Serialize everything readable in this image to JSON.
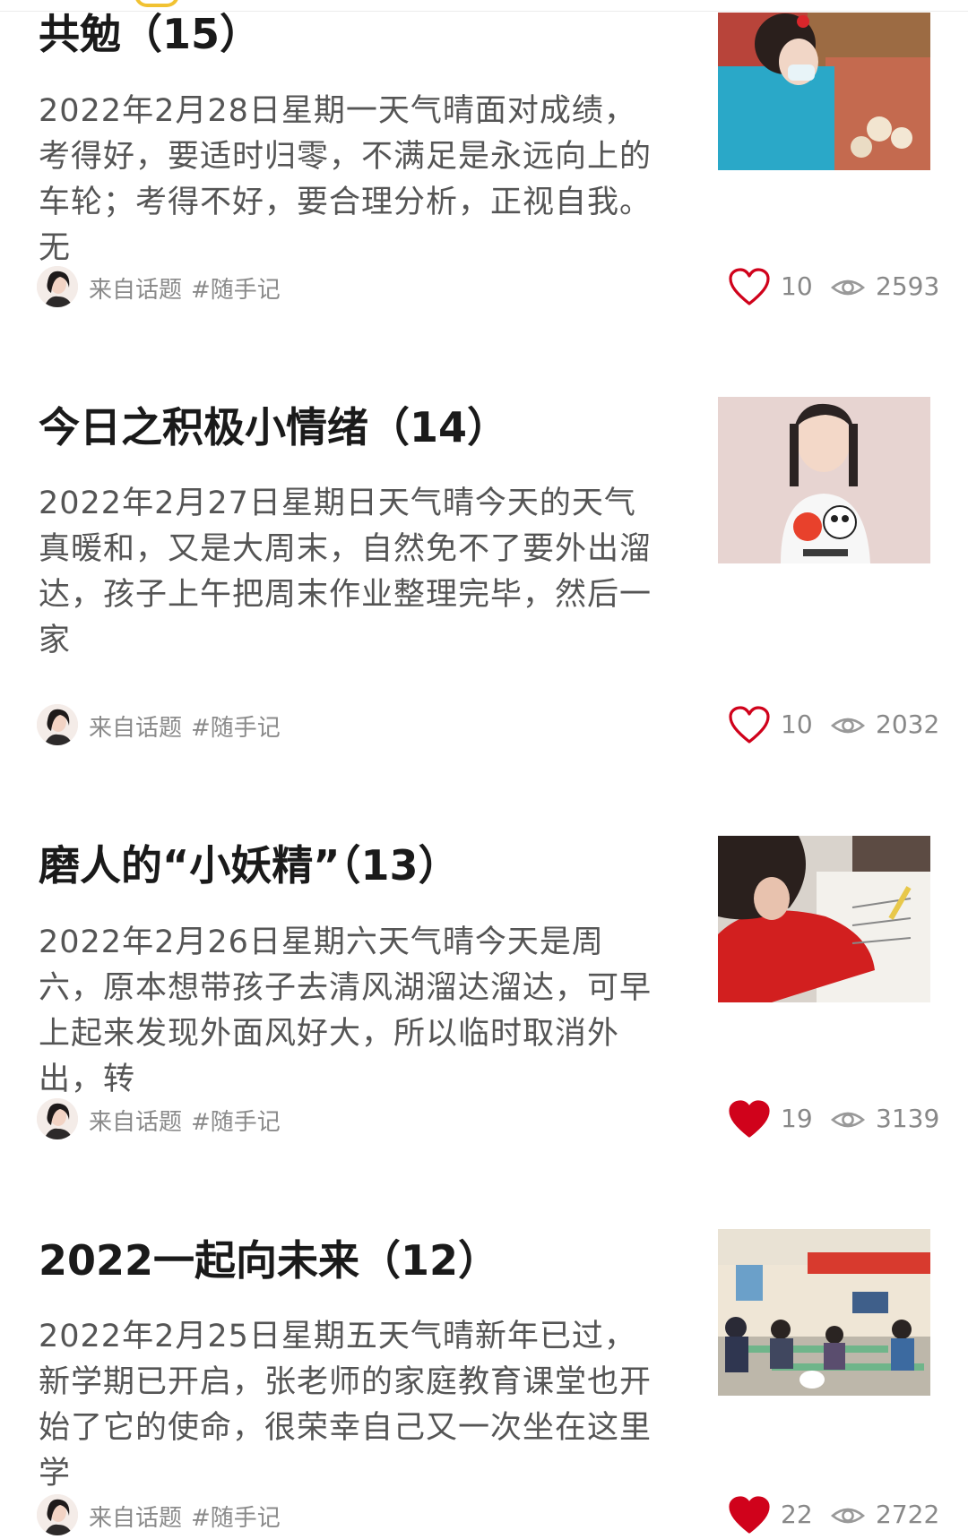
{
  "posts": [
    {
      "title": "共勉（15）",
      "excerpt": "2022年2月28日星期一天气晴面对成绩，考得好，要适时归零，不满足是永远向上的车轮；考得不好，要合理分析，正视自我。无",
      "source": "来自话题",
      "tag": "#随手记",
      "likes": "10",
      "liked": false,
      "views": "2593",
      "thumbnail": "girl-at-food-market-photo"
    },
    {
      "title": "今日之积极小情绪（14）",
      "excerpt": "2022年2月27日星期日天气晴今天的天气真暖和，又是大周末，自然免不了要外出溜达，孩子上午把周末作业整理完毕，然后一家",
      "source": "来自话题",
      "tag": "#随手记",
      "likes": "10",
      "liked": false,
      "views": "2032",
      "thumbnail": "girl-with-olympic-mascots-photo"
    },
    {
      "title": "磨人的“小妖精”（13）",
      "excerpt": "2022年2月26日星期六天气晴今天是周六，原本想带孩子去清风湖溜达溜达，可早上起来发现外面风好大，所以临时取消外出，转",
      "source": "来自话题",
      "tag": "#随手记",
      "likes": "19",
      "liked": true,
      "views": "3139",
      "thumbnail": "girl-doing-homework-photo"
    },
    {
      "title": "2022一起向未来（12）",
      "excerpt": "2022年2月25日星期五天气晴新年已过，新学期已开启，张老师的家庭教育课堂也开始了它的使命，很荣幸自己又一次坐在这里学",
      "source": "来自话题",
      "tag": "#随手记",
      "likes": "22",
      "liked": true,
      "views": "2722",
      "thumbnail": "parents-classroom-photo"
    }
  ],
  "colors": {
    "liked_heart": "#d0021b",
    "unliked_heart": "#d0021b",
    "muted_text": "#8a8a8a"
  },
  "icons": {
    "like": "heart-icon",
    "views": "eye-icon"
  }
}
